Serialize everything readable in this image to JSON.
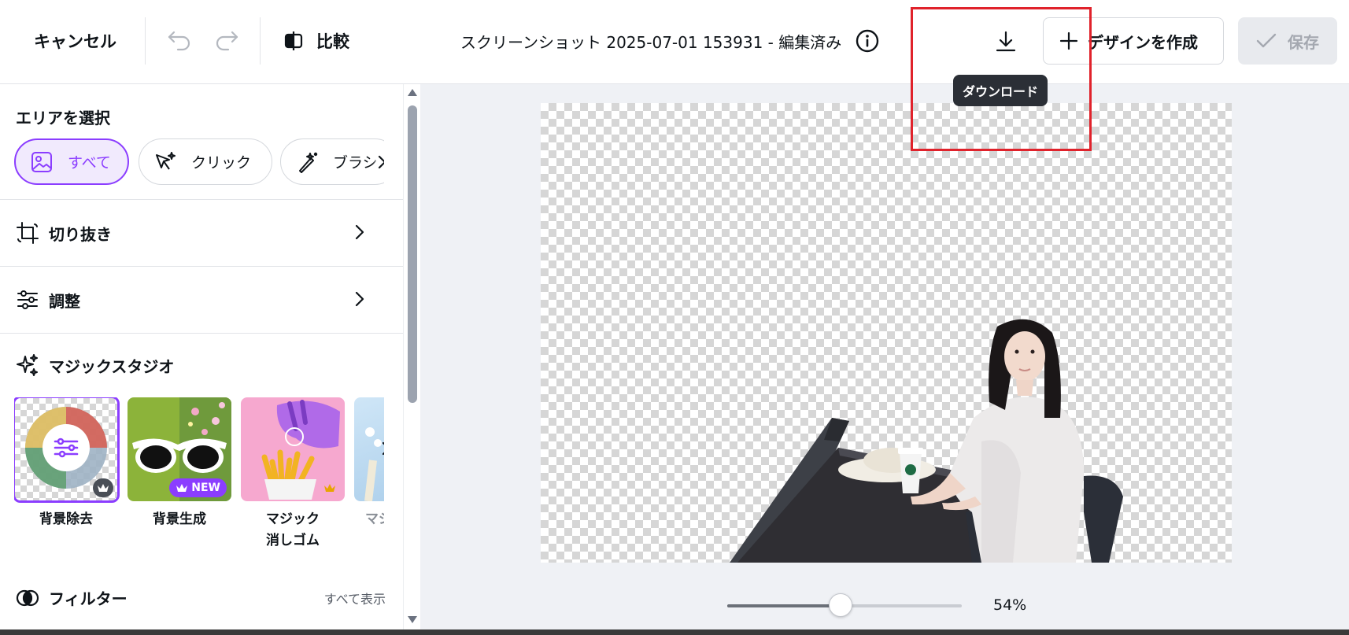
{
  "header": {
    "cancel_label": "キャンセル",
    "compare_label": "比較",
    "document_title": "スクリーンショット 2025-07-01 153931 - 編集済み",
    "create_design_label": "デザインを作成",
    "save_label": "保存",
    "download_tooltip": "ダウンロード"
  },
  "sidebar": {
    "select_area": {
      "title": "エリアを選択",
      "options": [
        {
          "label": "すべて",
          "icon": "image-icon",
          "active": true
        },
        {
          "label": "クリック",
          "icon": "magic-click-icon",
          "active": false
        },
        {
          "label": "ブラシ",
          "icon": "magic-brush-icon",
          "active": false
        }
      ]
    },
    "rows": [
      {
        "label": "切り抜き",
        "icon": "crop-icon"
      },
      {
        "label": "調整",
        "icon": "sliders-icon"
      }
    ],
    "magic_studio": {
      "title": "マジックスタジオ",
      "tools": [
        {
          "label": "背景除去",
          "badge": "crown",
          "selected": true
        },
        {
          "label": "背景生成",
          "badge": "NEW",
          "selected": false
        },
        {
          "label_line1": "マジック",
          "label_line2": "消しゴム",
          "badge": "crown",
          "selected": false
        },
        {
          "label": "マジック",
          "badge": "",
          "selected": false
        }
      ]
    },
    "filter": {
      "title": "フィルター",
      "show_all": "すべて表示"
    }
  },
  "canvas": {
    "zoom_percent": "54%",
    "zoom_fraction": 0.54
  },
  "colors": {
    "accent": "#8b3dff",
    "highlight_box": "#e0222b"
  }
}
